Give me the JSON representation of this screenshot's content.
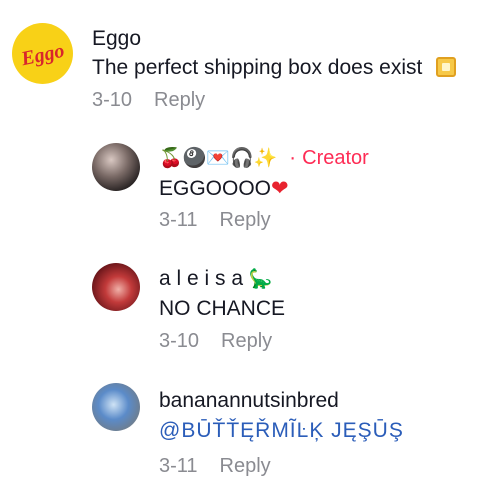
{
  "comments": [
    {
      "author": "Eggo",
      "text": "The perfect shipping box does exist",
      "emoji": "▣",
      "date": "3-10",
      "reply_label": "Reply",
      "avatar_logo_text": "Eggo"
    },
    {
      "author_emoji": "🍒🎱💌🎧✨",
      "creator_sep": "·",
      "creator_label": "Creator",
      "text": "EGGOOOO",
      "emoji": "❤",
      "date": "3-11",
      "reply_label": "Reply"
    },
    {
      "author": "a l e i s a",
      "author_emoji": "🦕",
      "text": "NO CHANCE",
      "date": "3-10",
      "reply_label": "Reply"
    },
    {
      "author": "bananannutsinbred",
      "text": "@BŪŤŤĘŘMĨĿĶ JĘŞŪŞ",
      "date": "3-11",
      "reply_label": "Reply"
    }
  ],
  "colors": {
    "creator": "#fe2c55",
    "mention": "#2b5db9",
    "meta": "#8a8b91",
    "eggo_yellow": "#f8d117",
    "eggo_red": "#d8262c"
  }
}
